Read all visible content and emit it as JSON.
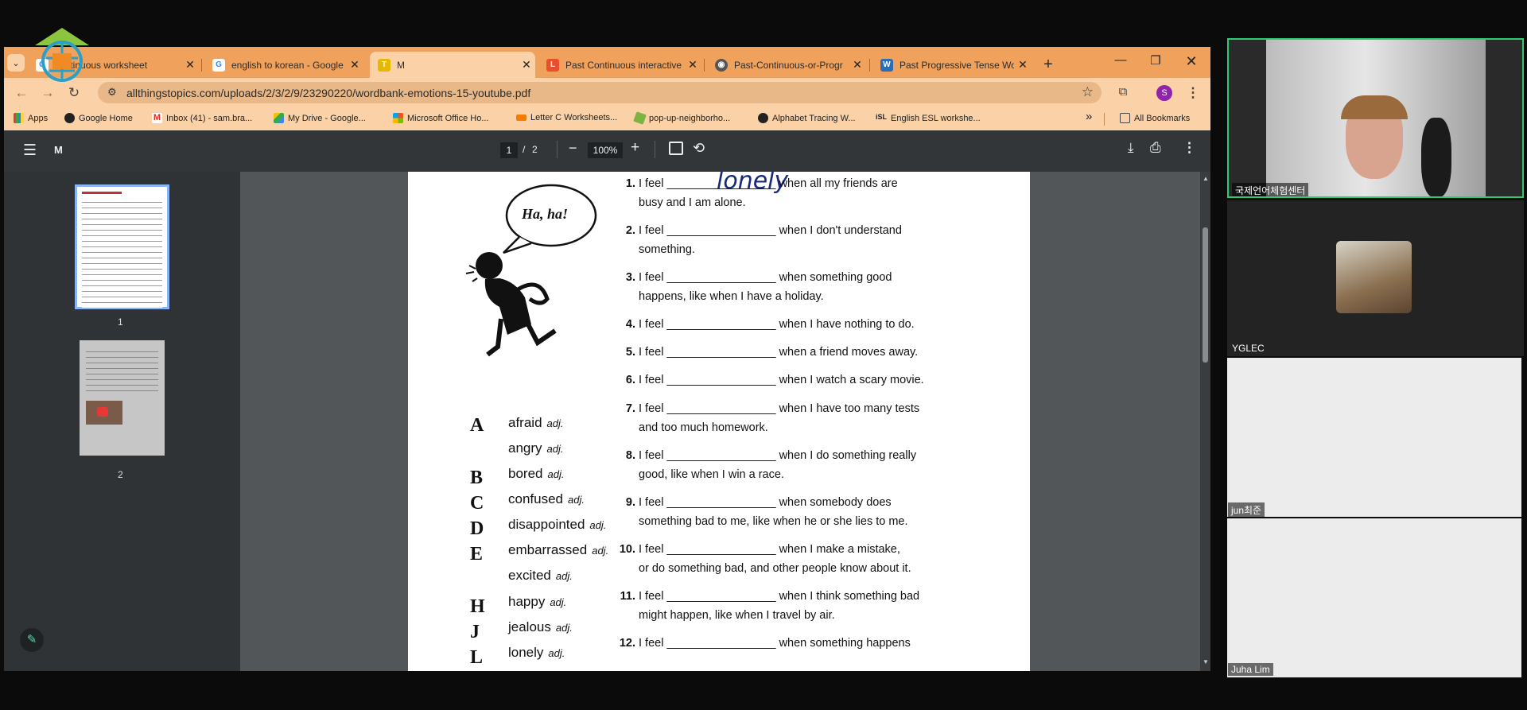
{
  "tabs": [
    {
      "title": "continuous worksheet",
      "icon": "google-icon"
    },
    {
      "title": "english to korean - Google",
      "icon": "google-icon"
    },
    {
      "title": "M",
      "icon": "page-icon"
    },
    {
      "title": "Past Continuous interactive",
      "icon": "liveworksheets-icon"
    },
    {
      "title": "Past-Continuous-or-Progr",
      "icon": "globe-icon"
    },
    {
      "title": "Past Progressive Tense Wo",
      "icon": "worksheet-icon"
    }
  ],
  "address": {
    "url": "allthingstopics.com/uploads/2/3/2/9/23290220/wordbank-emotions-15-youtube.pdf"
  },
  "profile_initial": "S",
  "bookmarks": [
    "Apps",
    "Google Home",
    "Inbox (41) - sam.bra...",
    "My Drive - Google...",
    "Microsoft Office Ho...",
    "Letter C Worksheets...",
    "pop-up-neighborho...",
    "Alphabet Tracing W...",
    "English ESL workshe..."
  ],
  "bookmarks_more": "»",
  "all_bookmarks": "All Bookmarks",
  "pdf": {
    "title": "M",
    "page_current": "1",
    "page_sep": "/",
    "page_total": "2",
    "zoom": "100%"
  },
  "thumbnails": [
    {
      "label": "1"
    },
    {
      "label": "2"
    }
  ],
  "worksheet": {
    "bubble": "Ha, ha!",
    "handwritten": "lonely",
    "questions": [
      {
        "n": "1.",
        "line1": "I feel _________________ when all my friends are",
        "line2": "busy and I am alone."
      },
      {
        "n": "2.",
        "line1": "I feel _________________ when I don't understand",
        "line2": "something."
      },
      {
        "n": "3.",
        "line1": "I feel _________________ when something good",
        "line2": "happens, like when I have a holiday."
      },
      {
        "n": "4.",
        "line1": "I feel _________________ when I have nothing to do.",
        "line2": ""
      },
      {
        "n": "5.",
        "line1": "I feel _________________ when a friend moves away.",
        "line2": ""
      },
      {
        "n": "6.",
        "line1": "I feel _________________ when I watch a scary movie.",
        "line2": ""
      },
      {
        "n": "7.",
        "line1": "I feel _________________ when I have too many tests",
        "line2": "and too much homework."
      },
      {
        "n": "8.",
        "line1": "I feel _________________ when I do something really",
        "line2": "good, like when I win a race."
      },
      {
        "n": "9.",
        "line1": "I feel _________________ when somebody does",
        "line2": "something bad to me, like when he or she lies to me."
      },
      {
        "n": "10.",
        "line1": "I feel _________________ when I make a mistake,",
        "line2": "or do something bad, and other people know about it."
      },
      {
        "n": "11.",
        "line1": "I feel _________________ when I think something bad",
        "line2": "might happen, like when I travel by air."
      },
      {
        "n": "12.",
        "line1": "I feel _________________ when something happens",
        "line2": ""
      }
    ],
    "letters": [
      "A",
      "B",
      "C",
      "D",
      "E",
      "H",
      "J",
      "L"
    ],
    "words": [
      {
        "word": "afraid",
        "pos": "adj."
      },
      {
        "word": "angry",
        "pos": "adj."
      },
      {
        "word": "bored",
        "pos": "adj."
      },
      {
        "word": "confused",
        "pos": "adj."
      },
      {
        "word": "disappointed",
        "pos": "adj."
      },
      {
        "word": "embarrassed",
        "pos": "adj."
      },
      {
        "word": "excited",
        "pos": "adj."
      },
      {
        "word": "happy",
        "pos": "adj."
      },
      {
        "word": "jealous",
        "pos": "adj."
      },
      {
        "word": "lonely",
        "pos": "adj."
      }
    ]
  },
  "participants": [
    {
      "name": "국제언어체험센터"
    },
    {
      "name": "YGLEC"
    },
    {
      "name": "jun최준"
    },
    {
      "name": "Juha Lim"
    }
  ],
  "colors": {
    "accent_tab": "#f0a25d",
    "active_speaker_border": "#2ecc71",
    "pdf_toolbar": "#323639"
  }
}
